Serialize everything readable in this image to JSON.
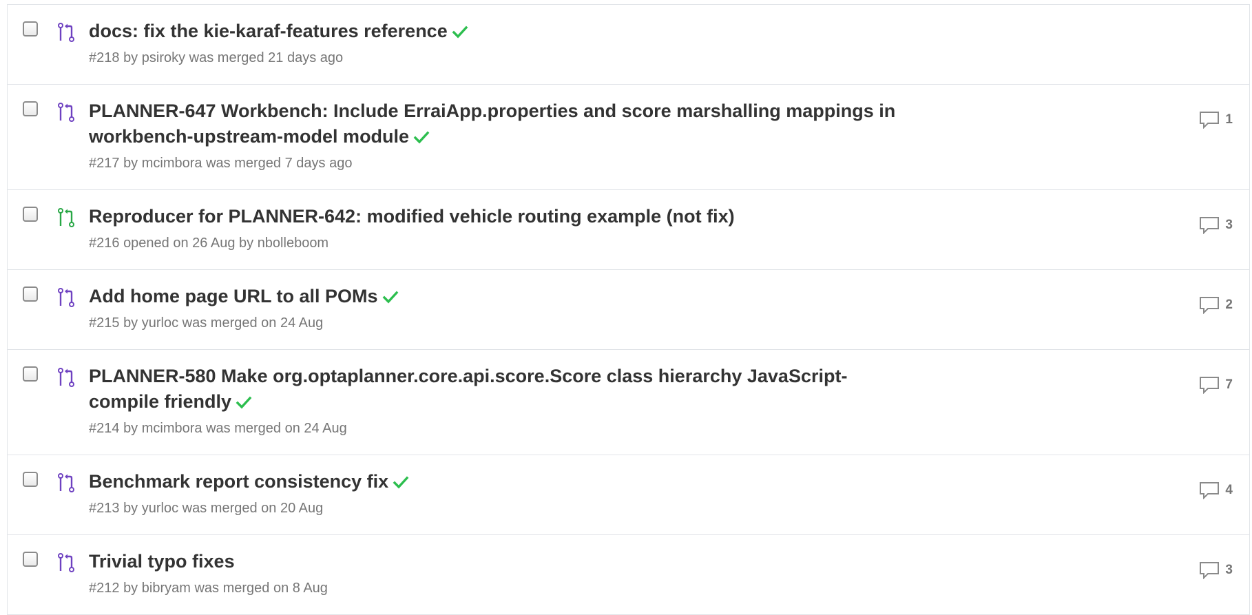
{
  "colors": {
    "merged_icon": "#6f42c1",
    "open_icon": "#28a745",
    "status_success": "#2cbe4e",
    "title_text": "#333333",
    "meta_text": "#767676",
    "border": "#e1e4e8"
  },
  "pull_requests": [
    {
      "state": "merged",
      "state_icon": "git-pull-request-icon",
      "title": "docs: fix the kie-karaf-features reference",
      "title_lines": null,
      "status_check": true,
      "number": "#218",
      "meta_pre": "by",
      "author": "psiroky",
      "meta_post": "was merged 21 days ago",
      "comments": null
    },
    {
      "state": "merged",
      "state_icon": "git-pull-request-icon",
      "title": "PLANNER-647 Workbench: Include ErraiApp.properties and score marshalling mappings in workbench-upstream-model module",
      "title_lines": [
        "PLANNER-647 Workbench: Include ErraiApp.properties and score marshalling mappings in",
        "workbench-upstream-model module"
      ],
      "status_check": true,
      "number": "#217",
      "meta_pre": "by",
      "author": "mcimbora",
      "meta_post": "was merged 7 days ago",
      "comments": "1"
    },
    {
      "state": "open",
      "state_icon": "git-pull-request-icon",
      "title": "Reproducer for PLANNER-642: modified vehicle routing example (not fix)",
      "title_lines": null,
      "status_check": false,
      "number": "#216",
      "meta_pre": "opened on 26 Aug by",
      "author": "nbolleboom",
      "meta_post": "",
      "comments": "3"
    },
    {
      "state": "merged",
      "state_icon": "git-pull-request-icon",
      "title": "Add home page URL to all POMs",
      "title_lines": null,
      "status_check": true,
      "number": "#215",
      "meta_pre": "by",
      "author": "yurloc",
      "meta_post": "was merged on 24 Aug",
      "comments": "2"
    },
    {
      "state": "merged",
      "state_icon": "git-pull-request-icon",
      "title": "PLANNER-580 Make org.optaplanner.core.api.score.Score class hierarchy JavaScript-compile friendly",
      "title_lines": [
        "PLANNER-580 Make org.optaplanner.core.api.score.Score class hierarchy JavaScript-",
        "compile friendly"
      ],
      "status_check": true,
      "number": "#214",
      "meta_pre": "by",
      "author": "mcimbora",
      "meta_post": "was merged on 24 Aug",
      "comments": "7"
    },
    {
      "state": "merged",
      "state_icon": "git-pull-request-icon",
      "title": "Benchmark report consistency fix",
      "title_lines": null,
      "status_check": true,
      "number": "#213",
      "meta_pre": "by",
      "author": "yurloc",
      "meta_post": "was merged on 20 Aug",
      "comments": "4"
    },
    {
      "state": "merged",
      "state_icon": "git-pull-request-icon",
      "title": "Trivial typo fixes",
      "title_lines": null,
      "status_check": false,
      "number": "#212",
      "meta_pre": "by",
      "author": "bibryam",
      "meta_post": "was merged on 8 Aug",
      "comments": "3"
    }
  ]
}
